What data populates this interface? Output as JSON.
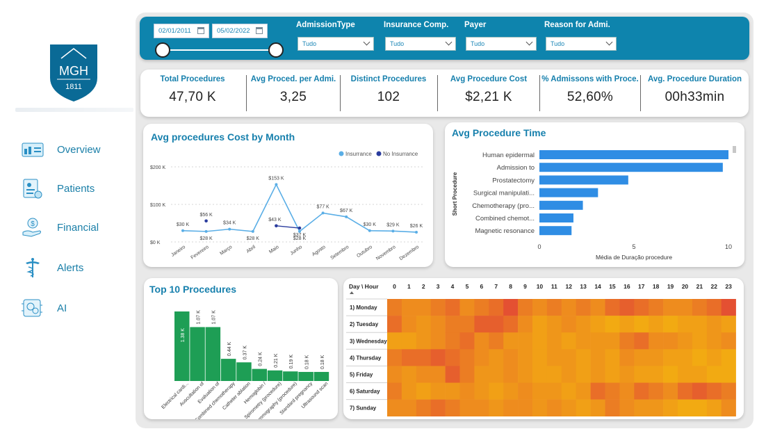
{
  "logo": {
    "initials": "MGH",
    "year": "1811"
  },
  "nav": [
    {
      "label": "Overview",
      "icon": "overview-dashboard-icon"
    },
    {
      "label": "Patients",
      "icon": "patients-clipboard-icon"
    },
    {
      "label": "Financial",
      "icon": "financial-hand-dollar-icon"
    },
    {
      "label": "Alerts",
      "icon": "alerts-caduceus-icon"
    },
    {
      "label": "AI",
      "icon": "ai-chip-icon"
    }
  ],
  "filters": {
    "date_start": "02/01/2011",
    "date_end": "05/02/2022",
    "admission_type": {
      "label": "AdmissionType",
      "value": "Tudo"
    },
    "insurance": {
      "label": "Insurance Comp.",
      "value": "Tudo"
    },
    "payer": {
      "label": "Payer",
      "value": "Tudo"
    },
    "reason": {
      "label": "Reason for Admi.",
      "value": "Tudo"
    }
  },
  "kpis": [
    {
      "title": "Total Procedures",
      "value": "47,70 K"
    },
    {
      "title": "Avg Proced. per Admi.",
      "value": "3,25"
    },
    {
      "title": "Distinct Procedures",
      "value": "102"
    },
    {
      "title": "Avg Procedure Cost",
      "value": "$2,21 K"
    },
    {
      "title": "% Admissons with Proce.",
      "value": "52,60%"
    },
    {
      "title": "Avg. Procedure Duration",
      "value": "00h33min"
    }
  ],
  "colors": {
    "accent": "#0e84ad",
    "title": "#1780ad",
    "line_insurance": "#5aaee6",
    "line_no_insurance": "#2a3c9e",
    "bar": "#2f8de4",
    "green": "#1e9e55"
  },
  "chart_data": [
    {
      "type": "line",
      "title": "Avg procedures Cost by Month",
      "legend": [
        "Insurrance",
        "No Insurrance"
      ],
      "categories": [
        "Janeiro",
        "Fevereiro",
        "Março",
        "Abril",
        "Maio",
        "Junho",
        "Agosto",
        "Setembro",
        "Outubro",
        "Novembro",
        "Dezembro"
      ],
      "yticks": [
        "$200 K",
        "$100 K",
        "$0 K"
      ],
      "ylim": [
        0,
        200
      ],
      "series": [
        {
          "name": "Insurrance",
          "values": [
            30,
            28,
            34,
            28,
            153,
            28,
            77,
            67,
            30,
            29,
            26
          ],
          "labels": [
            "$30 K",
            "$28 K",
            "$34 K",
            "$28 K",
            "$153 K",
            "$28 K",
            "$77 K",
            "$67 K",
            "$30 K",
            "$29 K",
            "$26 K"
          ]
        },
        {
          "name": "No Insurrance",
          "points": [
            {
              "x": 1,
              "y": 56,
              "label": "$56 K"
            },
            {
              "x": 4,
              "y": 43,
              "label": "$43 K"
            },
            {
              "x": 5,
              "y": 37,
              "label": "$37 K"
            }
          ]
        }
      ]
    },
    {
      "type": "bar",
      "orientation": "horizontal",
      "title": "Avg Procedure Time",
      "ylabel": "Short Procedure",
      "xlabel": "Média de Duração procedure",
      "categories": [
        "Human epidermal",
        "Admission to",
        "Prostatectomy",
        "Surgical manipulati...",
        "Chemotherapy (pro...",
        "Combined chemot...",
        "Magnetic resonance"
      ],
      "values": [
        10,
        9.7,
        4.7,
        3.1,
        2.3,
        1.8,
        1.7
      ],
      "xticks": [
        "0",
        "5",
        "10"
      ],
      "xlim": [
        0,
        10
      ]
    },
    {
      "type": "bar",
      "title": "Top 10 Procedures",
      "categories": [
        "Electrical cardi...",
        "Auscultation of",
        "Evaluation of",
        "Combined chemotherapy",
        "Catheter ablation",
        "Hemoglobin /",
        "Spirometry (procedure)",
        "Mammography (procedure)",
        "Standard pregnancy",
        "Ultrasound scan"
      ],
      "values": [
        1.38,
        1.07,
        1.07,
        0.44,
        0.37,
        0.24,
        0.21,
        0.19,
        0.18,
        0.18
      ],
      "labels": [
        "1.38 K",
        "1.07 K",
        "1.07 K",
        "0.44 K",
        "0.37 K",
        "0.24 K",
        "0.21 K",
        "0.19 K",
        "0.18 K",
        "0.18 K"
      ]
    },
    {
      "type": "heatmap",
      "corner_label": "Day \\ Hour",
      "hours": [
        "0",
        "1",
        "2",
        "3",
        "4",
        "5",
        "6",
        "7",
        "8",
        "9",
        "10",
        "11",
        "12",
        "13",
        "14",
        "15",
        "16",
        "17",
        "18",
        "19",
        "20",
        "21",
        "22",
        "23"
      ],
      "days": [
        "1) Monday",
        "2) Tuesday",
        "3) Wednesday",
        "4) Thursday",
        "5) Friday",
        "6) Saturday",
        "7) Sunday"
      ],
      "values": [
        [
          0.6,
          0.5,
          0.5,
          0.6,
          0.7,
          0.5,
          0.6,
          0.7,
          0.9,
          0.6,
          0.5,
          0.6,
          0.5,
          0.6,
          0.5,
          0.7,
          0.8,
          0.7,
          0.6,
          0.5,
          0.5,
          0.6,
          0.7,
          0.9
        ],
        [
          0.7,
          0.5,
          0.4,
          0.5,
          0.6,
          0.6,
          0.8,
          0.8,
          0.7,
          0.5,
          0.3,
          0.4,
          0.5,
          0.4,
          0.3,
          0.2,
          0.3,
          0.2,
          0.3,
          0.2,
          0.3,
          0.3,
          0.4,
          0.3
        ],
        [
          0.3,
          0.3,
          0.4,
          0.5,
          0.6,
          0.7,
          0.5,
          0.6,
          0.4,
          0.4,
          0.3,
          0.4,
          0.3,
          0.4,
          0.4,
          0.4,
          0.6,
          0.7,
          0.5,
          0.5,
          0.4,
          0.3,
          0.4,
          0.5
        ],
        [
          0.6,
          0.7,
          0.7,
          0.8,
          0.7,
          0.6,
          0.5,
          0.4,
          0.5,
          0.4,
          0.3,
          0.4,
          0.4,
          0.3,
          0.4,
          0.3,
          0.5,
          0.4,
          0.4,
          0.3,
          0.3,
          0.2,
          0.3,
          0.2
        ],
        [
          0.5,
          0.4,
          0.5,
          0.5,
          0.8,
          0.6,
          0.4,
          0.4,
          0.5,
          0.4,
          0.3,
          0.3,
          0.4,
          0.3,
          0.4,
          0.3,
          0.4,
          0.3,
          0.3,
          0.2,
          0.3,
          0.3,
          0.2,
          0.2
        ],
        [
          0.6,
          0.4,
          0.3,
          0.4,
          0.4,
          0.5,
          0.4,
          0.3,
          0.4,
          0.5,
          0.4,
          0.4,
          0.3,
          0.4,
          0.7,
          0.6,
          0.5,
          0.7,
          0.6,
          0.5,
          0.7,
          0.8,
          0.7,
          0.6
        ],
        [
          0.5,
          0.5,
          0.6,
          0.7,
          0.6,
          0.5,
          0.5,
          0.4,
          0.5,
          0.5,
          0.4,
          0.5,
          0.4,
          0.3,
          0.4,
          0.6,
          0.5,
          0.4,
          0.4,
          0.3,
          0.2,
          0.2,
          0.3,
          0.5
        ]
      ]
    }
  ]
}
